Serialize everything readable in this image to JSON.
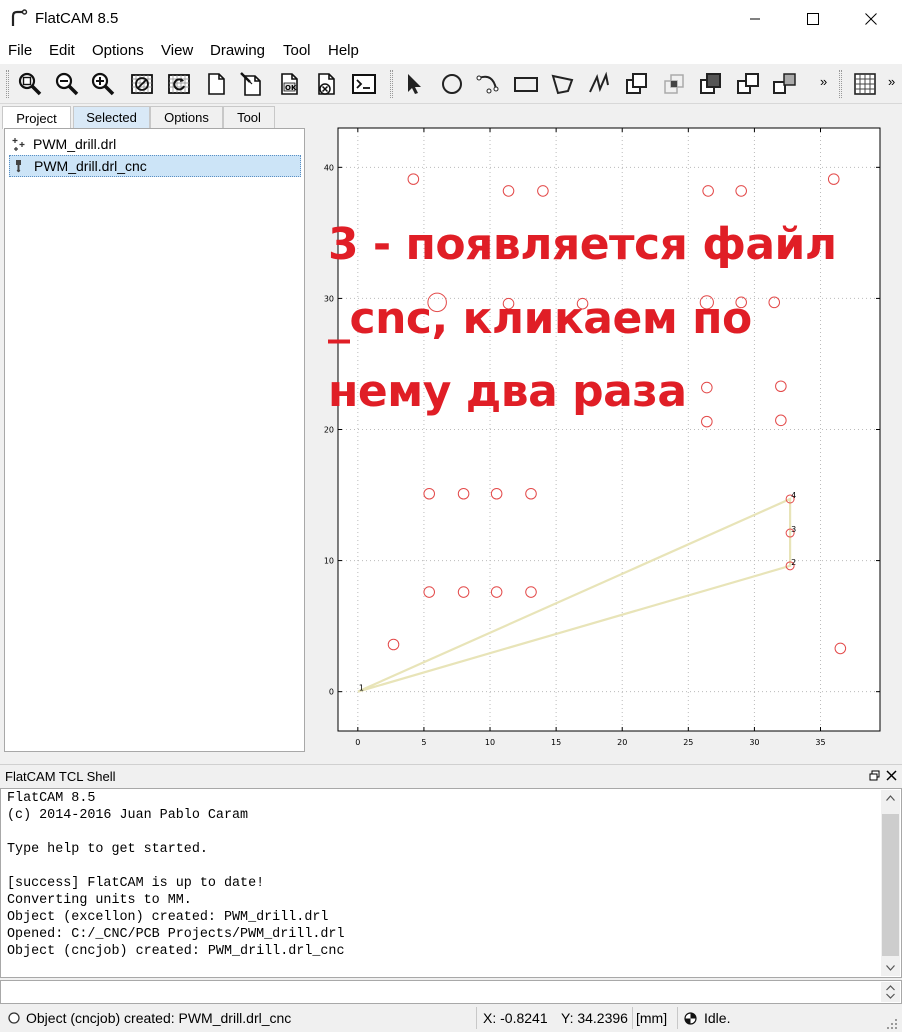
{
  "window": {
    "title": "FlatCAM 8.5"
  },
  "menu": {
    "items": [
      "File",
      "Edit",
      "Options",
      "View",
      "Drawing",
      "Tool",
      "Help"
    ]
  },
  "toolbar": {
    "icons": [
      "zoom-fit-icon",
      "zoom-out-icon",
      "zoom-in-icon",
      "clear-plot-icon",
      "replot-icon",
      "new-geometry-icon",
      "new-geometry-edit-icon",
      "ok-geometry-icon",
      "delete-icon",
      "shell-icon",
      "select-icon",
      "circle-icon",
      "arc-icon",
      "rectangle-icon",
      "polygon-icon",
      "path-icon",
      "union-icon",
      "intersection-icon",
      "subtraction-icon",
      "cut-icon",
      "move-icon",
      "grid-snap-icon"
    ],
    "more_label": "»"
  },
  "tabs": [
    "Project",
    "Selected",
    "Options",
    "Tool"
  ],
  "project": {
    "items": [
      {
        "label": "PWM_drill.drl",
        "icon": "excellon-icon"
      },
      {
        "label": "PWM_drill.drl_cnc",
        "icon": "cncjob-icon"
      }
    ]
  },
  "plot": {
    "x_ticks": [
      "0",
      "5",
      "10",
      "15",
      "20",
      "25",
      "30",
      "35"
    ],
    "y_ticks": [
      "0",
      "10",
      "20",
      "30",
      "40"
    ],
    "point_labels": [
      "1",
      "2",
      "3",
      "4"
    ]
  },
  "chart_data": {
    "type": "scatter",
    "title": "",
    "xlabel": "",
    "ylabel": "",
    "xlim": [
      -1.5,
      39.5
    ],
    "ylim": [
      -3,
      43
    ],
    "grid": true,
    "series": [
      {
        "points": [
          [
            4.2,
            39.1
          ],
          [
            11.4,
            38.2
          ],
          [
            14,
            38.2
          ],
          [
            26.5,
            38.2
          ],
          [
            29,
            38.2
          ],
          [
            36,
            39.1
          ],
          [
            6,
            29.7
          ],
          [
            11.4,
            29.6
          ],
          [
            17,
            29.6
          ],
          [
            26.4,
            29.7
          ],
          [
            29,
            29.7
          ],
          [
            31.5,
            29.7
          ],
          [
            26.4,
            23.2
          ],
          [
            32,
            23.3
          ],
          [
            26.4,
            20.6
          ],
          [
            32,
            20.7
          ],
          [
            5.4,
            15.1
          ],
          [
            8,
            15.1
          ],
          [
            10.5,
            15.1
          ],
          [
            13.1,
            15.1
          ],
          [
            5.4,
            7.6
          ],
          [
            8,
            7.6
          ],
          [
            10.5,
            7.6
          ],
          [
            13.1,
            7.6
          ],
          [
            2.7,
            3.6
          ],
          [
            36.5,
            3.3
          ],
          [
            32.7,
            9.6
          ],
          [
            32.7,
            12.1
          ],
          [
            32.7,
            14.7
          ]
        ],
        "radius": [
          0.4,
          0.4,
          0.4,
          0.4,
          0.4,
          0.4,
          0.7,
          0.4,
          0.4,
          0.5,
          0.4,
          0.4,
          0.4,
          0.4,
          0.4,
          0.4,
          0.4,
          0.4,
          0.4,
          0.4,
          0.4,
          0.4,
          0.4,
          0.4,
          0.4,
          0.4,
          0.3,
          0.3,
          0.3
        ],
        "color": "#e34a4a"
      }
    ],
    "toolpath": {
      "points": [
        [
          0,
          0
        ],
        [
          32.7,
          9.6
        ],
        [
          32.7,
          12.1
        ],
        [
          32.7,
          14.7
        ],
        [
          0,
          0
        ]
      ],
      "color": "#e8e4b8"
    }
  },
  "overlay_text": [
    "3 - появляется файл",
    "_cnc, кликаем по",
    "нему два раза"
  ],
  "shell": {
    "title": "FlatCAM TCL Shell",
    "lines": [
      "FlatCAM 8.5",
      "(c) 2014-2016 Juan Pablo Caram",
      "",
      "Type help to get started.",
      "",
      "[success] FlatCAM is up to date!",
      "Converting units to MM.",
      "Object (excellon) created: PWM_drill.drl",
      "Opened: C:/_CNC/PCB Projects/PWM_drill.drl",
      "Object (cncjob) created: PWM_drill.drl_cnc"
    ]
  },
  "status": {
    "message": "Object (cncjob) created: PWM_drill.drl_cnc",
    "x": "X: -0.8241",
    "y": "Y: 34.2396",
    "units": "[mm]",
    "state": "Idle."
  },
  "colors": {
    "overlay": "#e01e26",
    "drill": "#e34a4a",
    "toolpath": "#e8e4b8",
    "selection": "#cce4f7"
  }
}
